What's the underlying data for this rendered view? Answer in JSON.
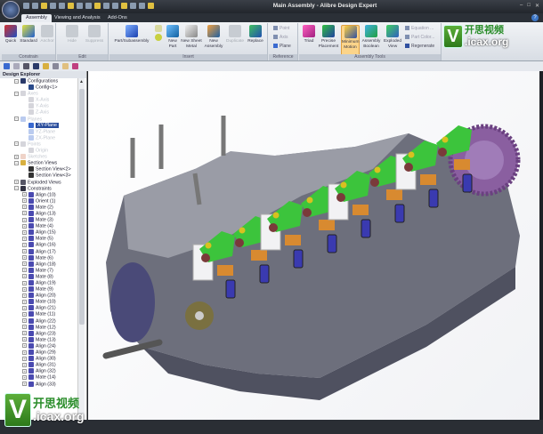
{
  "window": {
    "title": "Main Assembly - Alibre Design Expert",
    "controls": [
      "–",
      "□",
      "✕"
    ]
  },
  "tabs": [
    {
      "label": "Assembly",
      "active": true
    },
    {
      "label": "Viewing and Analysis"
    },
    {
      "label": "Add-Ons"
    }
  ],
  "ribbon": {
    "groups": [
      {
        "label": "Constrain"
      },
      {
        "label": "Edit"
      },
      {
        "label": "Insert"
      },
      {
        "label": "Reference"
      },
      {
        "label": "Assembly Tools"
      }
    ],
    "buttons": {
      "quick": "Quick",
      "standard": "Standard",
      "anchor": "Anchor",
      "hide": "Hide",
      "suppress": "Suppress",
      "part_subassembly": "Part/Subassembly",
      "new_part": "New Part",
      "new_sheet_metal": "New Sheet Metal",
      "new_assembly": "New Assembly",
      "duplicate": "Duplicate",
      "replace": "Replace",
      "point": "Point",
      "axis": "Axis",
      "plane": "Plane",
      "triad": "Triad",
      "precise_placement": "Precise Placement",
      "minimum_motion": "Minimum Motion",
      "assembly_boolean": "Assembly Boolean",
      "exploded_view": "Exploded View",
      "equation": "Equation ...",
      "part_color": "Part Color...",
      "regenerate": "Regenerate"
    }
  },
  "explorer": {
    "title": "Design Explorer",
    "top_nodes": [
      {
        "label": "Configurations",
        "depth": 0,
        "exp": "−",
        "color": "#2a3a6a"
      },
      {
        "label": "Config<1>",
        "depth": 1,
        "color": "#2a4a8a"
      },
      {
        "label": "Axes",
        "depth": 0,
        "exp": "−",
        "color": "#889",
        "faint": true
      },
      {
        "label": "X-Axis",
        "depth": 1,
        "color": "#889",
        "faint": true
      },
      {
        "label": "Y-Axis",
        "depth": 1,
        "color": "#889",
        "faint": true
      },
      {
        "label": "Z-Axis",
        "depth": 1,
        "color": "#889",
        "faint": true
      },
      {
        "label": "Planes",
        "depth": 0,
        "exp": "−",
        "color": "#3a6ad0",
        "faint": true
      },
      {
        "label": "XY-Plane",
        "depth": 1,
        "color": "#3a6ad0",
        "sel": true
      },
      {
        "label": "YZ-Plane",
        "depth": 1,
        "color": "#3a6ad0",
        "faint": true
      },
      {
        "label": "ZX-Plane",
        "depth": 1,
        "color": "#3a6ad0",
        "faint": true
      },
      {
        "label": "Points",
        "depth": 0,
        "exp": "−",
        "color": "#889",
        "faint": true
      },
      {
        "label": "Origin",
        "depth": 1,
        "color": "#889",
        "faint": true
      },
      {
        "label": "Sketches",
        "depth": 0,
        "color": "#d08060",
        "faint": true
      },
      {
        "label": "Section Views",
        "depth": 0,
        "exp": "−",
        "color": "#d8b040"
      },
      {
        "label": "Section View<2>",
        "depth": 1,
        "color": "#333"
      },
      {
        "label": "Section View<3>",
        "depth": 1,
        "color": "#333"
      },
      {
        "label": "Exploded Views",
        "depth": 0,
        "color": "#556"
      },
      {
        "label": "Constraints",
        "depth": 0,
        "exp": "−",
        "color": "#334"
      }
    ],
    "constraints": [
      "Align (10)",
      "Orient (1)",
      "Mate (2)",
      "Align (13)",
      "Mate (3)",
      "Mate (4)",
      "Align (15)",
      "Mate (5)",
      "Align (16)",
      "Align (17)",
      "Mate (6)",
      "Align (18)",
      "Mate (7)",
      "Mate (8)",
      "Align (19)",
      "Mate (9)",
      "Align (20)",
      "Mate (10)",
      "Align (21)",
      "Mate (11)",
      "Align (22)",
      "Mate (12)",
      "Align (23)",
      "Mate (13)",
      "Align (24)",
      "Align (29)",
      "Align (30)",
      "Align (31)",
      "Align (32)",
      "Mate (14)",
      "Align (33)"
    ]
  },
  "watermark": {
    "letter": "V",
    "cn": "开思视频",
    "url": ".icax.org"
  },
  "colors": {
    "accent": "#fbd48a",
    "selection": "#2a4d9c",
    "rocker": "#3cc43c",
    "block": "#6a6c78",
    "gear": "#8a5fa0"
  }
}
